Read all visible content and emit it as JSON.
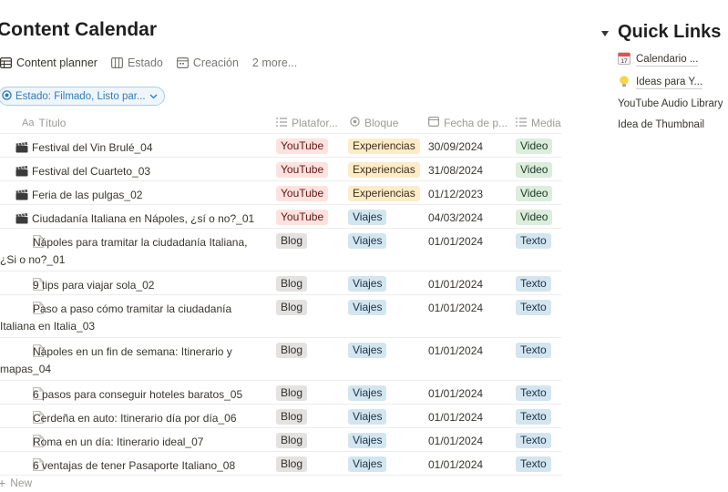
{
  "page_title": "Content Calendar",
  "views": [
    {
      "label": "Content planner",
      "icon": "table-icon"
    },
    {
      "label": "Estado",
      "icon": "board-icon"
    },
    {
      "label": "Creación",
      "icon": "calendar-view-icon"
    }
  ],
  "views_more": "2 more...",
  "filter": {
    "label": "Estado: Filmado, Listo par...",
    "icon": "status-filter-icon"
  },
  "columns": {
    "title": "Título",
    "title_prefix": "Aa",
    "platform": "Platafor...",
    "block": "Bloque",
    "date": "Fecha de p...",
    "media": "Media"
  },
  "rows": [
    {
      "title": "Festival del Vin Brulé_04",
      "icon": "clapperboard-icon",
      "platform": "YouTube",
      "block": "Experiencias",
      "date": "30/09/2024",
      "media": "Video"
    },
    {
      "title": "Festival del Cuarteto_03",
      "icon": "clapperboard-icon",
      "platform": "YouTube",
      "block": "Experiencias",
      "date": "31/08/2024",
      "media": "Video"
    },
    {
      "title": "Feria de las pulgas_02",
      "icon": "clapperboard-icon",
      "platform": "YouTube",
      "block": "Experiencias",
      "date": "01/12/2023",
      "media": "Video"
    },
    {
      "title": "Ciudadanía Italiana en Nápoles, ¿sí o no?_01",
      "icon": "clapperboard-icon",
      "platform": "YouTube",
      "block": "Viajes",
      "date": "04/03/2024",
      "media": "Video"
    },
    {
      "title": "Nápoles para tramitar la ciudadanía Italiana, ¿Si o no?_01",
      "icon": "page-icon",
      "platform": "Blog",
      "block": "Viajes",
      "date": "01/01/2024",
      "media": "Texto"
    },
    {
      "title": "9 tips para viajar sola_02",
      "icon": "page-icon",
      "platform": "Blog",
      "block": "Viajes",
      "date": "01/01/2024",
      "media": "Texto"
    },
    {
      "title": "Paso a paso cómo tramitar la ciudadanía Italiana en Italia_03",
      "icon": "page-icon",
      "platform": "Blog",
      "block": "Viajes",
      "date": "01/01/2024",
      "media": "Texto"
    },
    {
      "title": "Nápoles en un fin de semana: Itinerario y mapas_04",
      "icon": "page-icon",
      "platform": "Blog",
      "block": "Viajes",
      "date": "01/01/2024",
      "media": "Texto"
    },
    {
      "title": "6 pasos para conseguir hoteles baratos_05",
      "icon": "page-icon",
      "platform": "Blog",
      "block": "Viajes",
      "date": "01/01/2024",
      "media": "Texto"
    },
    {
      "title": "Cerdeña en auto: Itinerario día por día_06",
      "icon": "page-icon",
      "platform": "Blog",
      "block": "Viajes",
      "date": "01/01/2024",
      "media": "Texto"
    },
    {
      "title": "Roma en un día: Itinerario ideal_07",
      "icon": "page-icon",
      "platform": "Blog",
      "block": "Viajes",
      "date": "01/01/2024",
      "media": "Texto"
    },
    {
      "title": "6 ventajas de tener Pasaporte Italiano_08",
      "icon": "page-icon",
      "platform": "Blog",
      "block": "Viajes",
      "date": "01/01/2024",
      "media": "Texto"
    }
  ],
  "new_row_label": "New",
  "quick_links": {
    "title": "Quick Links",
    "items": [
      {
        "label": "Calendario ...",
        "icon": "calendar-icon"
      },
      {
        "label": "Ideas para Y...",
        "icon": "lightbulb-icon"
      },
      {
        "label": "YouTube Audio Library"
      },
      {
        "label": "Idea de Thumbnail"
      }
    ]
  },
  "tag_colors": {
    "YouTube": {
      "bg": "#ffe2dd",
      "fg": "#5d1715"
    },
    "Blog": {
      "bg": "#e3e2e0",
      "fg": "#32302c"
    },
    "Experiencias": {
      "bg": "#fdecc8",
      "fg": "#402c1b"
    },
    "Viajes": {
      "bg": "#d3e5ef",
      "fg": "#183347"
    },
    "Video": {
      "bg": "#dbeddb",
      "fg": "#1c3829"
    },
    "Texto": {
      "bg": "#d3e5ef",
      "fg": "#183347"
    }
  }
}
